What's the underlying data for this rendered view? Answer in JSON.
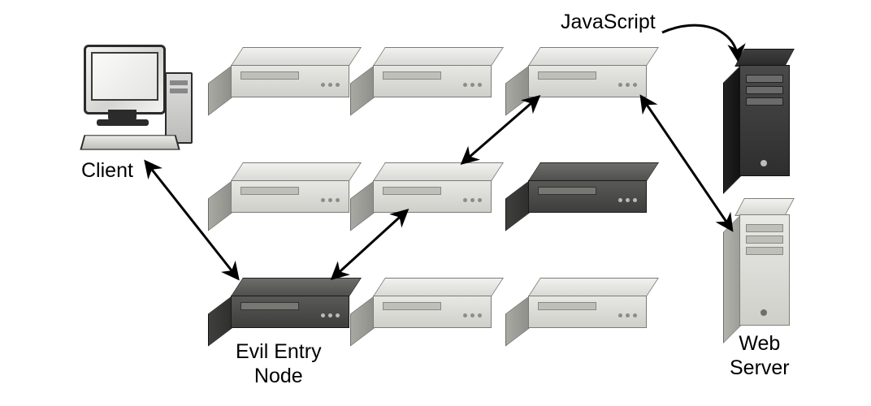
{
  "labels": {
    "client": "Client",
    "javascript": "JavaScript",
    "evil_entry_node": "Evil Entry\nNode",
    "web_server": "Web\nServer"
  },
  "nodes": {
    "client": {
      "role": "client-computer"
    },
    "relays": [
      {
        "row": 0,
        "col": 0,
        "type": "light"
      },
      {
        "row": 0,
        "col": 1,
        "type": "light"
      },
      {
        "row": 0,
        "col": 2,
        "type": "light",
        "role": "exit-node"
      },
      {
        "row": 1,
        "col": 0,
        "type": "light"
      },
      {
        "row": 1,
        "col": 1,
        "type": "light"
      },
      {
        "row": 1,
        "col": 2,
        "type": "dark"
      },
      {
        "row": 2,
        "col": 0,
        "type": "dark",
        "role": "evil-entry-node"
      },
      {
        "row": 2,
        "col": 1,
        "type": "light"
      },
      {
        "row": 2,
        "col": 2,
        "type": "light"
      }
    ],
    "servers": [
      {
        "role": "javascript-source",
        "style": "dark"
      },
      {
        "role": "web-server",
        "style": "light"
      }
    ]
  },
  "connections": [
    {
      "from": "client",
      "to": "evil-entry-node",
      "bidirectional": true
    },
    {
      "from": "evil-entry-node",
      "to": "middle-relay",
      "bidirectional": true
    },
    {
      "from": "middle-relay",
      "to": "exit-node",
      "bidirectional": true
    },
    {
      "from": "exit-node",
      "to": "web-server",
      "bidirectional": true
    },
    {
      "from": "exit-node",
      "to": "javascript-source",
      "type": "curved-inject"
    }
  ]
}
